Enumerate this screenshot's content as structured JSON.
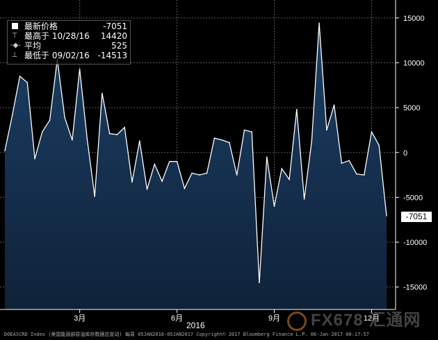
{
  "legend": {
    "rows": [
      {
        "symbol": "box",
        "label": "最新价格",
        "date": "",
        "value": "-7051"
      },
      {
        "symbol": "high",
        "label": "最高于",
        "date": "10/28/16",
        "value": "14420"
      },
      {
        "symbol": "avg",
        "label": "平均",
        "date": "",
        "value": "525"
      },
      {
        "symbol": "low",
        "label": "最低于",
        "date": "09/02/16",
        "value": "-14513"
      }
    ]
  },
  "last_value_tag": "-7051",
  "year_label": "2016",
  "footer_text": "DOEASCRD Index (美国能源部原油库存数据总变动)  每周 05JAN2016-05JAN2017 Copyright© 2017 Bloomberg Finance L.P. 06-Jan-2017 00:17:57",
  "watermark": "FX678 汇通网",
  "colors": {
    "line": "#ffffff",
    "area_top": "#1c3f66",
    "area_bottom": "#10243c",
    "background": "#000000"
  },
  "chart_data": {
    "type": "area",
    "x_tick_labels": [
      "3月",
      "6月",
      "9月",
      "12月"
    ],
    "x_tick_index": [
      10,
      23,
      36,
      49
    ],
    "y_ticks": [
      15000,
      10000,
      5000,
      0,
      -5000,
      -10000,
      -15000
    ],
    "ylim": [
      -17500,
      17000
    ],
    "grid": true,
    "legend_placement": "top-left",
    "series": [
      {
        "values": [
          200,
          4200,
          8500,
          7800,
          -700,
          2300,
          3600,
          10400,
          3900,
          1400,
          9300,
          1500,
          -4900,
          6600,
          2100,
          2000,
          2800,
          -3300,
          1300,
          -4100,
          -1300,
          -3200,
          -1000,
          -1000,
          -4000,
          -2300,
          -2500,
          -2300,
          1600,
          1400,
          1100,
          -2500,
          2500,
          2300,
          -14513,
          -500,
          -6000,
          -1800,
          -3000,
          4800,
          -5200,
          1300,
          14420,
          2500,
          5300,
          -1200,
          -900,
          -2400,
          -2500,
          2300,
          800,
          -7051
        ]
      }
    ]
  }
}
